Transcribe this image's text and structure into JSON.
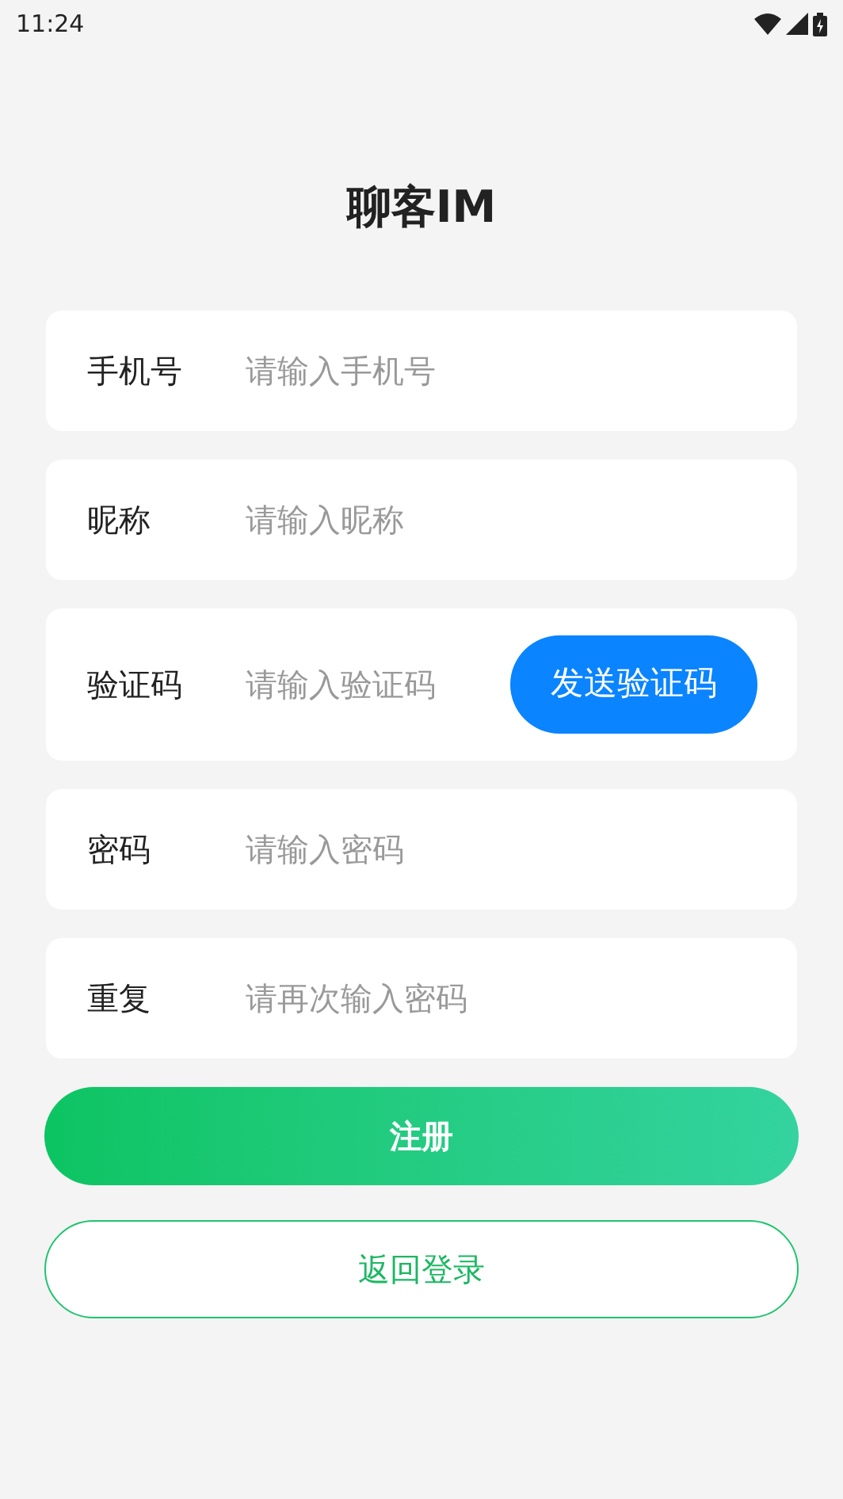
{
  "status_bar": {
    "time": "11:24"
  },
  "title": "聊客IM",
  "fields": [
    {
      "kind": "plain",
      "label": "手机号",
      "placeholder": "请输入手机号"
    },
    {
      "kind": "plain",
      "label": "昵称",
      "placeholder": "请输入昵称"
    },
    {
      "kind": "code",
      "label": "验证码",
      "placeholder": "请输入验证码",
      "action": "发送验证码"
    },
    {
      "kind": "plain",
      "label": "密码",
      "placeholder": "请输入密码"
    },
    {
      "kind": "plain",
      "label": "重复",
      "placeholder": "请再次输入密码"
    }
  ],
  "buttons": [
    {
      "kind": "primary",
      "label": "注册"
    },
    {
      "kind": "outline",
      "label": "返回登录"
    }
  ]
}
